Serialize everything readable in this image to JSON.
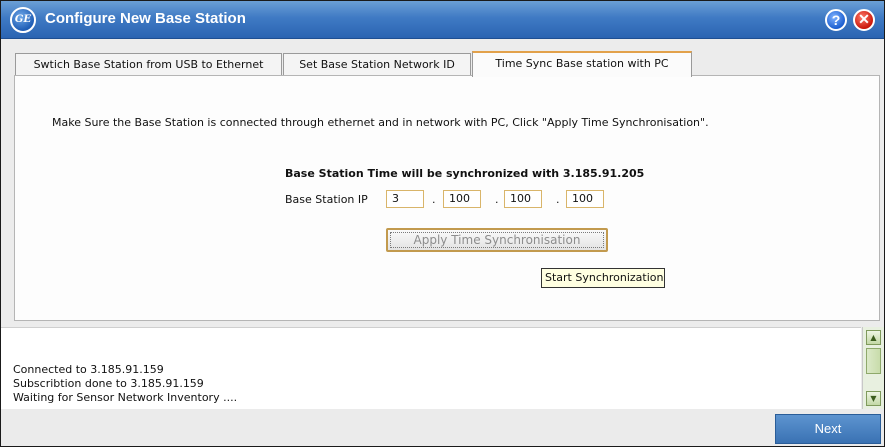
{
  "window": {
    "title": "Configure New Base Station",
    "logo_text": "GE",
    "help_glyph": "?",
    "close_glyph": "✕"
  },
  "tabs": [
    {
      "label": "Swtich Base Station from USB to Ethernet",
      "active": false
    },
    {
      "label": "Set Base Station Network ID",
      "active": false
    },
    {
      "label": "Time Sync Base station with PC",
      "active": true
    }
  ],
  "panel": {
    "instruction": "Make Sure the Base Station is connected through ethernet and in network with PC, Click \"Apply Time Synchronisation\".",
    "sync_message": "Base Station Time will be synchronized with 3.185.91.205",
    "ip_label": "Base Station IP",
    "ip_octets": [
      "3",
      "100",
      "100",
      "100"
    ],
    "ip_separator": ".",
    "apply_button": "Apply Time Synchronisation",
    "tooltip": "Start Synchronization"
  },
  "log": {
    "lines": [
      "Connected to 3.185.91.159",
      "Subscribtion done to 3.185.91.159",
      "Waiting for Sensor Network Inventory ...."
    ]
  },
  "footer": {
    "next_button": "Next"
  },
  "colors": {
    "titlebar": "#3f7ac4",
    "active_tab_accent": "#e2a14a",
    "next_button": "#4a84c2"
  }
}
